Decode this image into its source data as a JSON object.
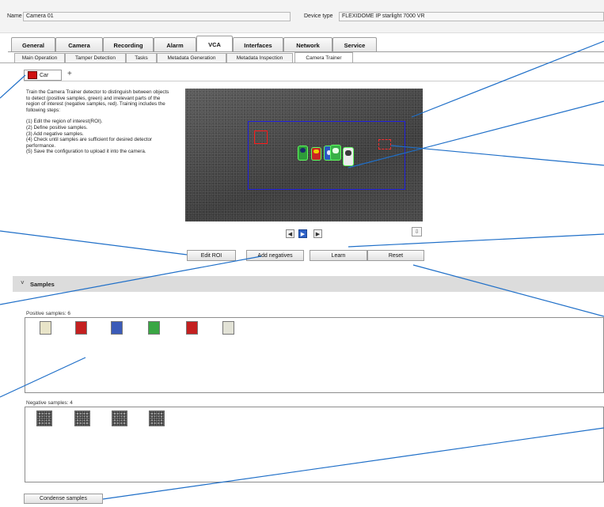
{
  "header": {
    "name_label": "Name",
    "name_value": "Camera 01",
    "device_type_label": "Device type",
    "device_type_value": "FLEXIDOME IP starlight 7000 VR"
  },
  "main_tabs": [
    "General",
    "Camera",
    "Recording",
    "Alarm",
    "VCA",
    "Interfaces",
    "Network",
    "Service"
  ],
  "active_main_tab": "VCA",
  "sub_tabs": [
    "Main Operation",
    "Tamper Detection",
    "Tasks",
    "Metadata Generation",
    "Metadata Inspection",
    "Camera Trainer"
  ],
  "active_sub_tab": "Camera Trainer",
  "detector": {
    "label": "Car",
    "add": "+",
    "color": "#d01010"
  },
  "instructions": {
    "intro": "Train the Camera Trainer detector to distinguish between objects to detect (positive samples, green) and irrelevant parts of the region of interest (negative samples, red). Training includes the following steps:",
    "steps": [
      "(1) Edit the region of interest(ROI).",
      "(2) Define positive samples.",
      "(3) Add negative samples.",
      "(4) Check until samples are sufficient for desired detector performance.",
      "(5) Save the configuration to upload it into the camera."
    ]
  },
  "video_controls": {
    "prev": "◀",
    "play": "▶",
    "next": "▶",
    "download": "⇩"
  },
  "actions": {
    "edit_roi": "Edit ROI",
    "add_negatives": "Add negatives",
    "learn": "Learn",
    "reset": "Reset"
  },
  "samples": {
    "title": "Samples",
    "chevron": "˅",
    "positive_label": "Positive samples: 6",
    "negative_label": "Negative samples: 4",
    "positive_colors": [
      "#e8e4c8",
      "#c42020",
      "#3b5bb8",
      "#3aa644",
      "#c42020",
      "#e2e2d6"
    ],
    "negative_count": 4
  },
  "condense_button": "Condense samples",
  "colors": {
    "roi": "#2020e0",
    "negative_box": "#ff1a1a",
    "callout": "#1f6fc8",
    "positive_outline": "#35e035"
  }
}
